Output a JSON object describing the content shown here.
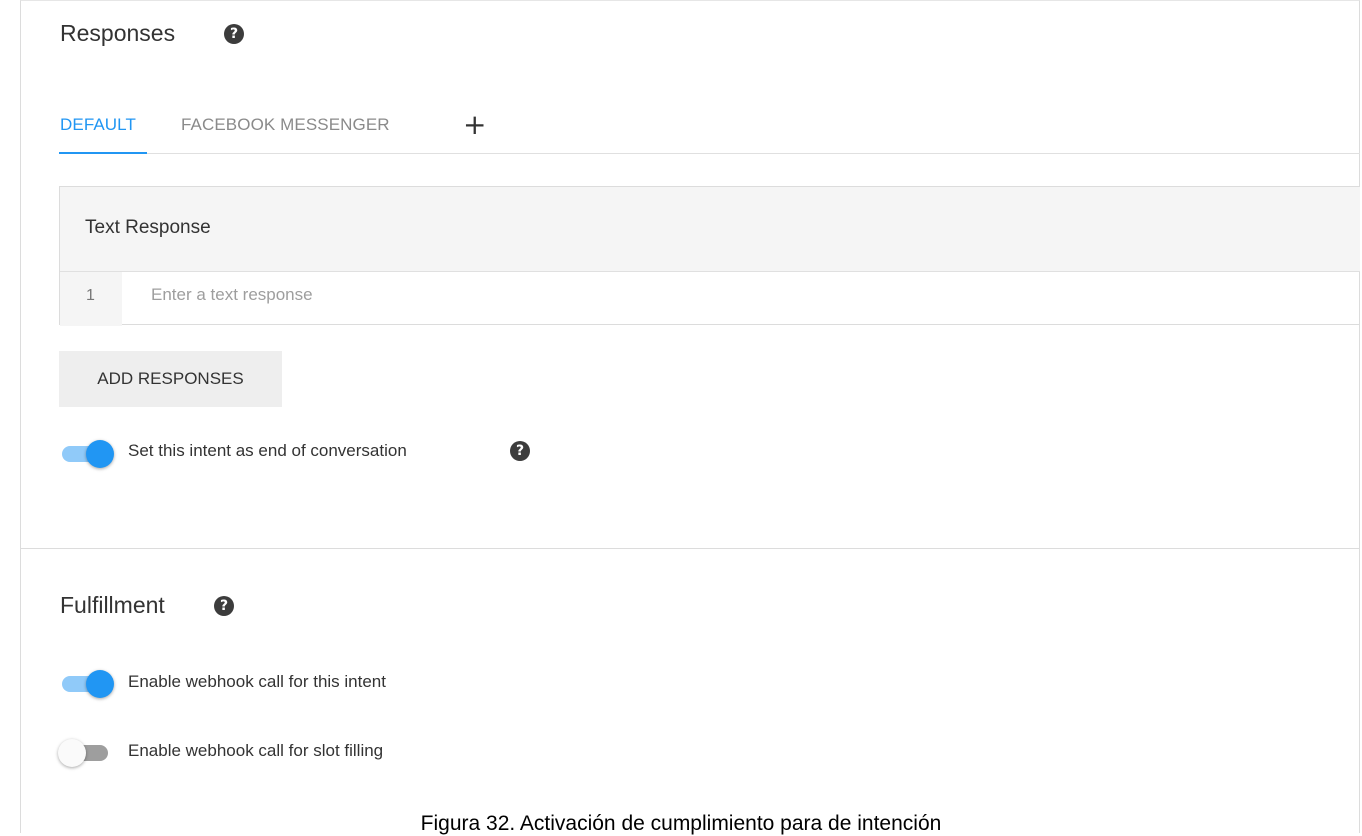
{
  "responses": {
    "title": "Responses",
    "help_glyph": "?",
    "tabs": [
      {
        "label": "DEFAULT",
        "active": true
      },
      {
        "label": "FACEBOOK MESSENGER",
        "active": false
      }
    ],
    "add_tab_glyph": "+",
    "text_response": {
      "title": "Text Response",
      "rows": [
        {
          "index": "1",
          "value": "",
          "placeholder": "Enter a text response"
        }
      ]
    },
    "add_button_label": "ADD RESPONSES",
    "end_conversation": {
      "label": "Set this intent as end of conversation",
      "enabled": true
    }
  },
  "fulfillment": {
    "title": "Fulfillment",
    "help_glyph": "?",
    "toggles": [
      {
        "label": "Enable webhook call for this intent",
        "enabled": true
      },
      {
        "label": "Enable webhook call for slot filling",
        "enabled": false
      }
    ]
  },
  "caption": "Figura 32. Activación de cumplimiento para de intención",
  "colors": {
    "accent": "#2196f3",
    "accent_light": "#90caf9",
    "inactive_tab": "#8a8a8a",
    "card_header_bg": "#f5f5f5",
    "button_bg": "#eeeeee"
  },
  "icons": {
    "help": "help-circle-icon",
    "add_tab": "plus-icon"
  }
}
